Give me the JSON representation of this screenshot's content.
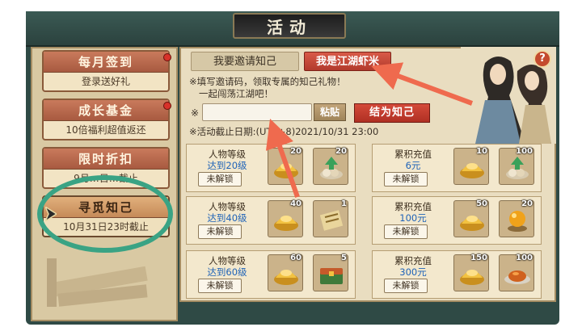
{
  "window": {
    "title": "活动"
  },
  "left_menu": {
    "items": [
      {
        "title": "每月签到",
        "subtitle": "登录送好礼",
        "badge": true
      },
      {
        "title": "成长基金",
        "subtitle": "10倍福利超值返还",
        "badge": true
      },
      {
        "title": "限时折扣",
        "subtitle": "9月…日…截止",
        "badge": false
      },
      {
        "title": "寻觅知己",
        "subtitle": "10月31日23时截止",
        "badge": false,
        "active": true
      }
    ]
  },
  "tabs": {
    "invite": "我要邀请知己",
    "self": "我是江湖虾米"
  },
  "help_label": "?",
  "description": {
    "line1": "※填写邀请码，领取专属的知己礼物！",
    "line2": "一起闯荡江湖吧！"
  },
  "invite_code": {
    "star": "※",
    "value": "",
    "placeholder": "",
    "paste_label": "粘贴",
    "submit_label": "结为知己"
  },
  "deadline": "※活动截止日期:(UTC+8)2021/10/31 23:00",
  "rewards": {
    "lock_label": "未解锁",
    "level": [
      {
        "title": "人物等级",
        "condition": "达到20级",
        "items": [
          {
            "icon": "gold-ingot-icon",
            "count": "20"
          },
          {
            "icon": "upgrade-pill-icon",
            "count": "20"
          }
        ]
      },
      {
        "title": "人物等级",
        "condition": "达到40级",
        "items": [
          {
            "icon": "gold-ingot-icon",
            "count": "40"
          },
          {
            "icon": "scroll-icon",
            "count": "1"
          }
        ]
      },
      {
        "title": "人物等级",
        "condition": "达到60级",
        "items": [
          {
            "icon": "gold-ingot-icon",
            "count": "60"
          },
          {
            "icon": "treasure-box-icon",
            "count": "5"
          }
        ]
      }
    ],
    "recharge": [
      {
        "title": "累积充值",
        "condition": "6元",
        "items": [
          {
            "icon": "gold-ingot-icon",
            "count": "10"
          },
          {
            "icon": "upgrade-pill-icon",
            "count": "100"
          }
        ]
      },
      {
        "title": "累积充值",
        "condition": "100元",
        "items": [
          {
            "icon": "gold-ingot-icon",
            "count": "50"
          },
          {
            "icon": "orb-icon",
            "count": "20"
          }
        ]
      },
      {
        "title": "累积充值",
        "condition": "300元",
        "items": [
          {
            "icon": "gold-ingot-icon",
            "count": "150"
          },
          {
            "icon": "food-plate-icon",
            "count": "100"
          }
        ]
      }
    ]
  },
  "colors": {
    "accent_red": "#d8322a",
    "highlight_teal": "#3aa384",
    "annotation_arrow": "#ef6a4e",
    "condition_blue": "#1f63b8"
  }
}
